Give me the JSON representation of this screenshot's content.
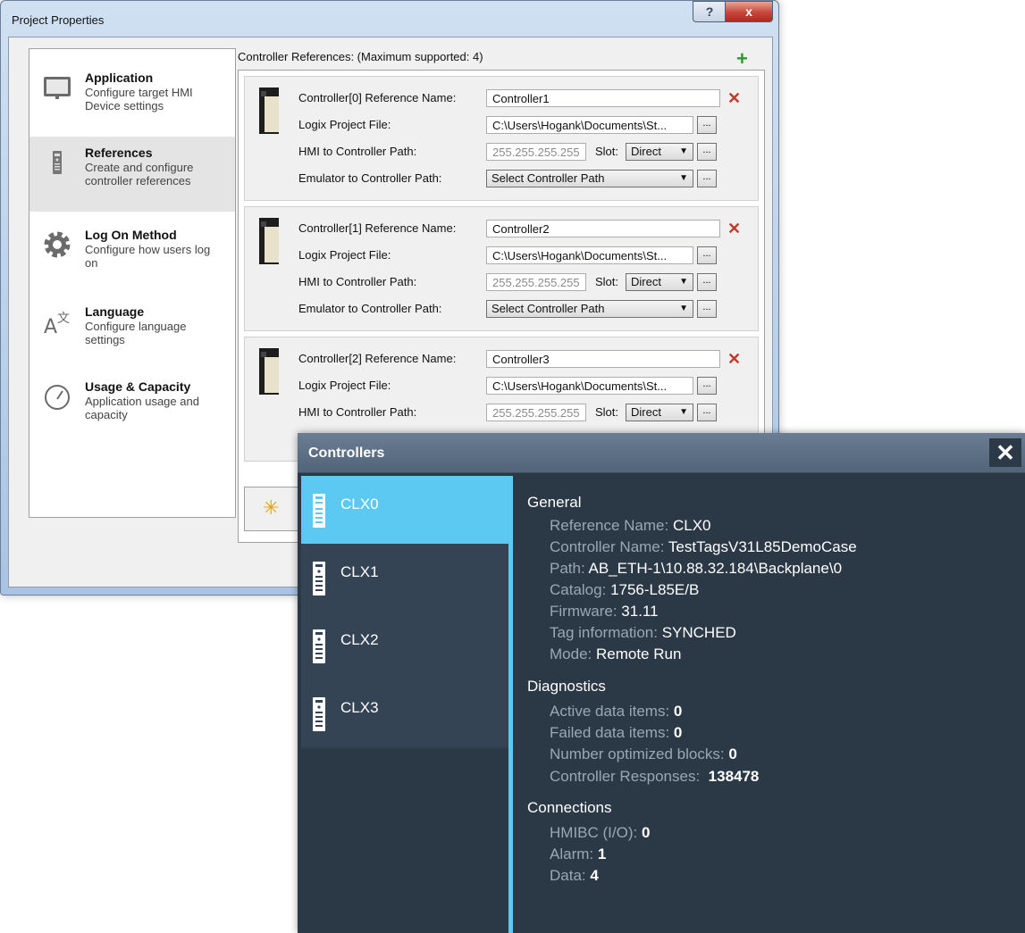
{
  "project_properties": {
    "title": "Project Properties",
    "help_label": "?",
    "close_label": "x",
    "sidebar": [
      {
        "title": "Application",
        "desc": "Configure target HMI Device settings",
        "icon": "monitor-icon"
      },
      {
        "title": "References",
        "desc": "Create and configure controller references",
        "icon": "controller-icon"
      },
      {
        "title": "Log On Method",
        "desc": "Configure how users log on",
        "icon": "gear-icon"
      },
      {
        "title": "Language",
        "desc": "Configure language settings",
        "icon": "language-icon"
      },
      {
        "title": "Usage & Capacity",
        "desc": "Application usage and capacity",
        "icon": "gauge-icon"
      }
    ],
    "refs_label": "Controller References: (Maximum supported: 4)",
    "add_icon": "+",
    "labels": {
      "logix_file": "Logix Project File:",
      "hmi_path": "HMI to Controller Path:",
      "emu_path": "Emulator to Controller Path:",
      "slot": "Slot:",
      "ellipsis": "...",
      "delete": "✕"
    },
    "references": [
      {
        "name_label": "Controller[0] Reference Name:",
        "name": "Controller1",
        "file": "C:\\Users\\Hogank\\Documents\\St...",
        "ip": "255.255.255.255",
        "slot": "Direct",
        "emu": "Select Controller Path"
      },
      {
        "name_label": "Controller[1] Reference Name:",
        "name": "Controller2",
        "file": "C:\\Users\\Hogank\\Documents\\St...",
        "ip": "255.255.255.255",
        "slot": "Direct",
        "emu": "Select Controller Path"
      },
      {
        "name_label": "Controller[2] Reference Name:",
        "name": "Controller3",
        "file": "C:\\Users\\Hogank\\Documents\\St...",
        "ip": "255.255.255.255",
        "slot": "Direct"
      }
    ]
  },
  "controllers": {
    "title": "Controllers",
    "close_label": "✕",
    "list": [
      "CLX0",
      "CLX1",
      "CLX2",
      "CLX3"
    ],
    "selected": "CLX0",
    "general": {
      "heading": "General",
      "reference_name_k": "Reference Name:",
      "reference_name_v": "CLX0",
      "controller_name_k": "Controller Name:",
      "controller_name_v": "TestTagsV31L85DemoCase",
      "path_k": "Path:",
      "path_v": "AB_ETH-1\\10.88.32.184\\Backplane\\0",
      "catalog_k": "Catalog:",
      "catalog_v": "1756-L85E/B",
      "firmware_k": "Firmware:",
      "firmware_v": "31.11",
      "tag_info_k": "Tag information:",
      "tag_info_v": "SYNCHED",
      "mode_k": "Mode:",
      "mode_v": "Remote Run"
    },
    "diagnostics": {
      "heading": "Diagnostics",
      "active_k": "Active data items:",
      "active_v": "0",
      "failed_k": "Failed data items:",
      "failed_v": "0",
      "blocks_k": "Number optimized blocks:",
      "blocks_v": "0",
      "responses_k": "Controller Responses:",
      "responses_v": "138478"
    },
    "connections": {
      "heading": "Connections",
      "hmibc_k": "HMIBC (I/O):",
      "hmibc_v": "0",
      "alarm_k": "Alarm:",
      "alarm_v": "1",
      "data_k": "Data:",
      "data_v": "4"
    }
  }
}
